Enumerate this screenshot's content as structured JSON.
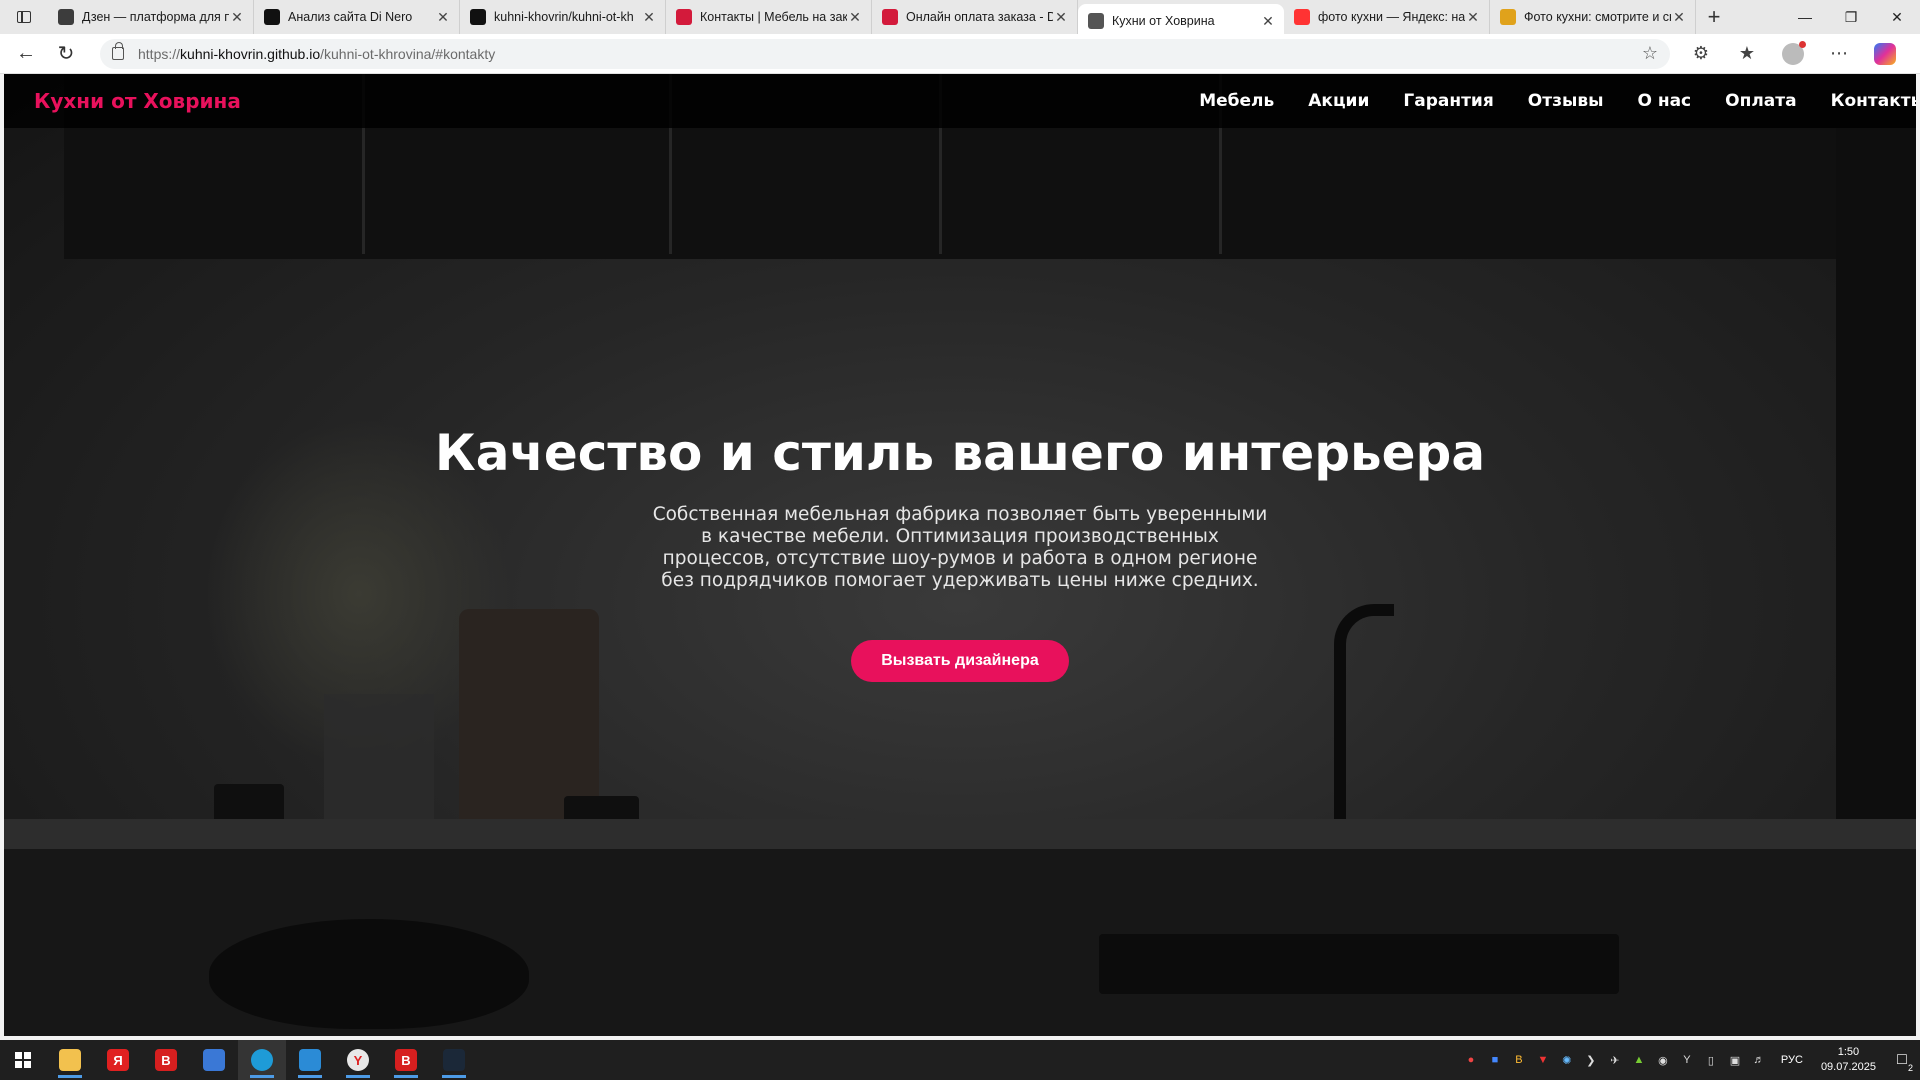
{
  "browser": {
    "tabs": [
      {
        "title": "Дзен — платформа для пр",
        "favicon": "dzen-icon",
        "color": "#3c3c3c"
      },
      {
        "title": "Анализ сайта Di Nero",
        "favicon": "chatgpt-icon",
        "color": "#111111"
      },
      {
        "title": "kuhni-khovrin/kuhni-ot-kh",
        "favicon": "github-icon",
        "color": "#111111"
      },
      {
        "title": "Контакты | Мебель на зака",
        "favicon": "dinero-icon",
        "color": "#d31a3b"
      },
      {
        "title": "Онлайн оплата заказа - Di",
        "favicon": "dinero-icon",
        "color": "#d31a3b"
      },
      {
        "title": "Кухни от Ховрина",
        "favicon": "globe-icon",
        "color": "#555555"
      },
      {
        "title": "фото кухни — Яндекс: нашл",
        "favicon": "yandex-icon",
        "color": "#f33"
      },
      {
        "title": "Фото кухни: смотрите и ск",
        "favicon": "images-icon",
        "color": "#e0a21b"
      }
    ],
    "active_tab_index": 5,
    "url": {
      "scheme": "https://",
      "host": "kuhni-khovrin.github.io",
      "path": "/kuhni-ot-khrovina/#kontakty"
    }
  },
  "site": {
    "logo": "Кухни от Ховрина",
    "nav": [
      "Мебель",
      "Акции",
      "Гарантия",
      "Отзывы",
      "О нас",
      "Оплата",
      "Контакты"
    ],
    "hero": {
      "title": "Качество и стиль вашего интерьера",
      "text": "Собственная мебельная фабрика позволяет быть уверенными в качестве мебели. Оптимизация производственных процессов, отсутствие шоу-румов и работа в одном регионе без подрядчиков помогает удерживать цены ниже средних.",
      "cta": "Вызвать дизайнера"
    },
    "accent_color": "#e8115c"
  },
  "taskbar": {
    "apps": [
      {
        "name": "file-explorer-icon",
        "label": "",
        "color": "#f2c14e"
      },
      {
        "name": "yandex-icon",
        "label": "Я",
        "color": "#e02020"
      },
      {
        "name": "vivaldi-icon",
        "label": "B",
        "color": "#d61f1f"
      },
      {
        "name": "store-icon",
        "label": "",
        "color": "#3a78d6"
      },
      {
        "name": "edge-icon",
        "label": "",
        "color": "#1e9bd7"
      },
      {
        "name": "app-icon",
        "label": "",
        "color": "#2b8bd6"
      },
      {
        "name": "yandex-browser-icon",
        "label": "Y",
        "color": "#e8e8e8"
      },
      {
        "name": "vivaldi-icon",
        "label": "B",
        "color": "#d61f1f"
      },
      {
        "name": "steam-icon",
        "label": "",
        "color": "#1b2838"
      }
    ],
    "language": "РУС",
    "time": "1:50",
    "date": "09.07.2025",
    "notifications": "2"
  }
}
